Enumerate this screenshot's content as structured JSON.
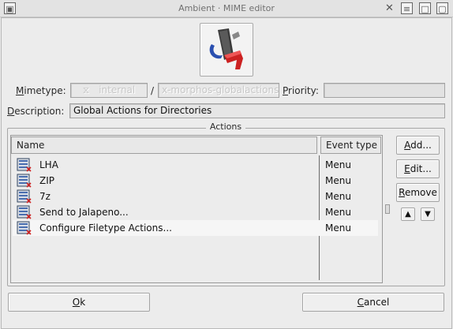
{
  "window": {
    "title": "Ambient · MIME editor",
    "controls": {
      "menu": "▣",
      "close": "✕",
      "shade": "≡",
      "iconify": "□",
      "maximize": "▢"
    }
  },
  "icon_name": "mime-type-icon",
  "mimetype": {
    "label_m": "M",
    "label_rest": "imetype:",
    "main_type": "internal",
    "separator": "/",
    "sub_type": "x-morphos-globalactions"
  },
  "priority": {
    "label_p": "P",
    "label_rest": "riority:",
    "value": ""
  },
  "description": {
    "label_d": "D",
    "label_rest": "escription:",
    "value": "Global Actions for Directories"
  },
  "actions": {
    "group_title": "Actions",
    "columns": {
      "name": "Name",
      "event_type": "Event type"
    },
    "rows": [
      {
        "name": "LHA",
        "event_type": "Menu",
        "icon": "archive-icon"
      },
      {
        "name": "ZIP",
        "event_type": "Menu",
        "icon": "archive-icon"
      },
      {
        "name": "7z",
        "event_type": "Menu",
        "icon": "archive-icon"
      },
      {
        "name": "Send to Jalapeno...",
        "event_type": "Menu",
        "icon": "archive-icon"
      },
      {
        "name": "Configure Filetype Actions...",
        "event_type": "Menu",
        "icon": "archive-icon"
      }
    ],
    "selected_row": 4
  },
  "buttons": {
    "add": {
      "u": "A",
      "rest": "dd..."
    },
    "edit": {
      "u": "E",
      "rest": "dit..."
    },
    "remove": {
      "u": "R",
      "rest": "emove"
    },
    "up": "▲",
    "down": "▼",
    "ok": {
      "u": "O",
      "rest": "k"
    },
    "cancel": {
      "u": "C",
      "rest": "ancel"
    }
  },
  "colors": {
    "background": "#ececec",
    "icon_red": "#cc2222",
    "icon_blue": "#2a4fb0"
  }
}
